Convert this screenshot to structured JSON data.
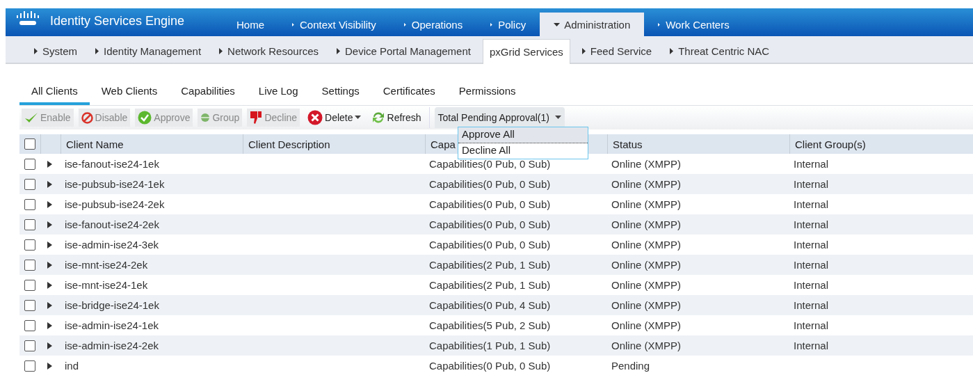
{
  "header": {
    "product": "Identity Services Engine",
    "menu": [
      {
        "label": "Home",
        "selected": false,
        "arrow": false
      },
      {
        "label": "Context Visibility",
        "selected": false,
        "arrow": true
      },
      {
        "label": "Operations",
        "selected": false,
        "arrow": true
      },
      {
        "label": "Policy",
        "selected": false,
        "arrow": true
      },
      {
        "label": "Administration",
        "selected": true,
        "arrow": true
      },
      {
        "label": "Work Centers",
        "selected": false,
        "arrow": true
      }
    ]
  },
  "subnav": [
    {
      "label": "System",
      "selected": false,
      "arrow": true
    },
    {
      "label": "Identity Management",
      "selected": false,
      "arrow": true
    },
    {
      "label": "Network Resources",
      "selected": false,
      "arrow": true
    },
    {
      "label": "Device Portal Management",
      "selected": false,
      "arrow": true
    },
    {
      "label": "pxGrid Services",
      "selected": true,
      "arrow": false
    },
    {
      "label": "Feed Service",
      "selected": false,
      "arrow": true
    },
    {
      "label": "Threat Centric NAC",
      "selected": false,
      "arrow": true
    }
  ],
  "tabs": [
    {
      "label": "All Clients",
      "selected": true
    },
    {
      "label": "Web Clients",
      "selected": false
    },
    {
      "label": "Capabilities",
      "selected": false
    },
    {
      "label": "Live Log",
      "selected": false
    },
    {
      "label": "Settings",
      "selected": false
    },
    {
      "label": "Certificates",
      "selected": false
    },
    {
      "label": "Permissions",
      "selected": false
    }
  ],
  "toolbar": [
    {
      "kind": "enable",
      "label": "Enable",
      "disabled": true
    },
    {
      "kind": "disable",
      "label": "Disable",
      "disabled": true
    },
    {
      "kind": "approve",
      "label": "Approve",
      "disabled": true
    },
    {
      "kind": "group",
      "label": "Group",
      "disabled": true
    },
    {
      "kind": "decline",
      "label": "Decline",
      "disabled": true
    },
    {
      "kind": "delete",
      "label": "Delete",
      "disabled": false,
      "caret": true
    },
    {
      "kind": "refresh",
      "label": "Refresh",
      "disabled": false
    }
  ],
  "pending": {
    "label": "Total Pending Approval(1)",
    "expanded": true,
    "options": [
      {
        "label": "Approve All",
        "selected": true
      },
      {
        "label": "Decline All",
        "selected": false
      }
    ]
  },
  "table": {
    "select_all": {
      "checked": false
    },
    "columns": [
      "Client Name",
      "Client Description",
      "Capa",
      "Status",
      "Client Group(s)"
    ],
    "rows": [
      {
        "checked": false,
        "expanded": false,
        "name": "ise-fanout-ise24-1ek",
        "capabilities": "Capabilities(0 Pub, 0 Sub)",
        "status": "Online (XMPP)",
        "group": "Internal"
      },
      {
        "checked": false,
        "expanded": false,
        "name": "ise-pubsub-ise24-1ek",
        "capabilities": "Capabilities(0 Pub, 0 Sub)",
        "status": "Online (XMPP)",
        "group": "Internal"
      },
      {
        "checked": false,
        "expanded": false,
        "name": "ise-pubsub-ise24-2ek",
        "capabilities": "Capabilities(0 Pub, 0 Sub)",
        "status": "Online (XMPP)",
        "group": "Internal"
      },
      {
        "checked": false,
        "expanded": false,
        "name": "ise-fanout-ise24-2ek",
        "capabilities": "Capabilities(0 Pub, 0 Sub)",
        "status": "Online (XMPP)",
        "group": "Internal"
      },
      {
        "checked": false,
        "expanded": false,
        "name": "ise-admin-ise24-3ek",
        "capabilities": "Capabilities(0 Pub, 0 Sub)",
        "status": "Online (XMPP)",
        "group": "Internal"
      },
      {
        "checked": false,
        "expanded": false,
        "name": "ise-mnt-ise24-2ek",
        "capabilities": "Capabilities(2 Pub, 1 Sub)",
        "status": "Online (XMPP)",
        "group": "Internal"
      },
      {
        "checked": false,
        "expanded": false,
        "name": "ise-mnt-ise24-1ek",
        "capabilities": "Capabilities(2 Pub, 1 Sub)",
        "status": "Online (XMPP)",
        "group": "Internal"
      },
      {
        "checked": false,
        "expanded": false,
        "name": "ise-bridge-ise24-1ek",
        "capabilities": "Capabilities(0 Pub, 4 Sub)",
        "status": "Online (XMPP)",
        "group": "Internal"
      },
      {
        "checked": false,
        "expanded": false,
        "name": "ise-admin-ise24-1ek",
        "capabilities": "Capabilities(5 Pub, 2 Sub)",
        "status": "Online (XMPP)",
        "group": "Internal"
      },
      {
        "checked": false,
        "expanded": false,
        "name": "ise-admin-ise24-2ek",
        "capabilities": "Capabilities(1 Pub, 1 Sub)",
        "status": "Online (XMPP)",
        "group": "Internal"
      },
      {
        "checked": false,
        "expanded": false,
        "name": "ind",
        "capabilities": "Capabilities(0 Pub, 0 Sub)",
        "status": "Pending"
      }
    ]
  }
}
